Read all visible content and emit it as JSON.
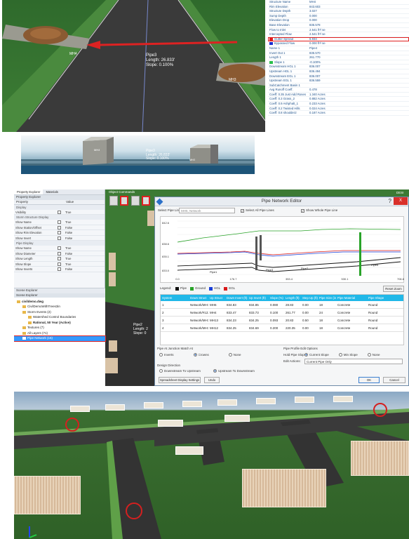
{
  "panel1": {
    "pipe_label": "Pipe3",
    "pipe_length": "Length: 26.833'",
    "pipe_slope": "Slope: 0.100%",
    "mh_left": "MH4",
    "mh_right": "MH3",
    "properties": [
      {
        "k": "Structure Name",
        "v": "MH4",
        "sw": ""
      },
      {
        "k": "Rim Elevation",
        "v": "843.603",
        "sw": ""
      },
      {
        "k": "Structure Depth",
        "v": "3.027",
        "sw": ""
      },
      {
        "k": "Sump Depth",
        "v": "0.000",
        "sw": ""
      },
      {
        "k": "Elevation Drop",
        "v": "0.000",
        "sw": ""
      },
      {
        "k": "Base Elevation",
        "v": "835.578",
        "sw": ""
      },
      {
        "k": "Flow to Inlet",
        "v": "2.541 ft³/ se",
        "sw": ""
      },
      {
        "k": "Intercepted Flow",
        "v": "2.541 ft³/ se",
        "sw": ""
      },
      {
        "k": "Gutter Spread",
        "v": "6.934",
        "sw": "#e02020",
        "highlight": true
      },
      {
        "k": "Bypassed Flow",
        "v": "0.000 ft³/ se",
        "sw": "#1a2bd0"
      },
      {
        "k": "Name 1",
        "v": "Pipe4",
        "sw": ""
      },
      {
        "k": "Invert Out 1",
        "v": "835.570",
        "sw": ""
      },
      {
        "k": "Length 1",
        "v": "261.770",
        "sw": ""
      },
      {
        "k": "Slope 1",
        "v": "-0.100%",
        "sw": "#29c04a"
      },
      {
        "k": "Downstream HGL 1",
        "v": "836.007",
        "sw": ""
      },
      {
        "k": "Upstream HGL 1",
        "v": "836.494",
        "sw": ""
      },
      {
        "k": "Downstream EGL 1",
        "v": "836.007",
        "sw": ""
      },
      {
        "k": "Upstream EGL 1",
        "v": "836.559",
        "sw": ""
      },
      {
        "k": "SubCatchment Basin 1",
        "v": "",
        "sw": ""
      },
      {
        "k": "Avg Runoff Coeff.",
        "v": "0.478",
        "sw": ""
      },
      {
        "k": "Coeff: 0.35 Just Add Roses",
        "v": "1.340 Acres",
        "sw": ""
      },
      {
        "k": "Coeff: 0.3 Grass_2",
        "v": "0.882 Acres",
        "sw": ""
      },
      {
        "k": "Coeff: 0.9 Ashphalt_1",
        "v": "0.233 Acres",
        "sw": ""
      },
      {
        "k": "Coeff: 0.2 Twisted Hills",
        "v": "0.024 Acres",
        "sw": ""
      },
      {
        "k": "Coeff: 0.8 shoulder2",
        "v": "0.187 Acres",
        "sw": ""
      }
    ]
  },
  "panel2": {
    "pipe_label": "Pipe3",
    "pipe_length": "Length: 26.833'",
    "pipe_slope": "Slope: 0.100%",
    "mh_left": "MH4",
    "mh_right": "MH3"
  },
  "panel3": {
    "tabs": [
      "Property Explorer",
      "Materials"
    ],
    "property_explorer_title": "Property Explorer",
    "col_property": "Property",
    "col_value": "Value",
    "properties": [
      {
        "group": "Display"
      },
      {
        "k": "Visibility",
        "v": "True",
        "checked": true
      },
      {
        "group": "Storm Structure Display"
      },
      {
        "k": "Show Name",
        "v": "True",
        "checked": true
      },
      {
        "k": "Show Station/Offset",
        "v": "False",
        "checked": false
      },
      {
        "k": "Show Rim Elevation",
        "v": "False",
        "checked": false
      },
      {
        "k": "Show Invert",
        "v": "False",
        "checked": false
      },
      {
        "group": "Pipe Display"
      },
      {
        "k": "Show Name",
        "v": "True",
        "checked": true
      },
      {
        "k": "Show Diameter",
        "v": "False",
        "checked": false
      },
      {
        "k": "Show Length",
        "v": "True",
        "checked": true
      },
      {
        "k": "Show Slope",
        "v": "True",
        "checked": true
      },
      {
        "k": "Show Inverts",
        "v": "False",
        "checked": false
      }
    ],
    "scene_explorer_tab": "Scene Explorer",
    "scene_explorer_title": "Scene Explorer",
    "tree": [
      {
        "label": "civildemo.dwg",
        "level": 0,
        "bold": true
      },
      {
        "label": "CivilDemoWithTrees3in",
        "level": 1
      },
      {
        "label": "Storm Events (2)",
        "level": 1
      },
      {
        "label": "Watershed Control Boundaries",
        "level": 2
      },
      {
        "label": "Rational, 50 Year (Active)",
        "level": 2,
        "bold": true
      },
      {
        "label": "Textures (7)",
        "level": 1
      },
      {
        "label": "All Layers (71)",
        "level": 1
      },
      {
        "label": "Pipe Network (15)",
        "level": 1,
        "selected": true
      }
    ],
    "object_commands": "Object Commands",
    "bg_pipe_label": "Pipe2",
    "bg_pipe_length": "Length: 2",
    "bg_pipe_slope": "Slope: 0",
    "editor": {
      "title": "Pipe Network Editor",
      "help": "?",
      "close": "X",
      "select_pipe_line_label": "Select Pipe Line:",
      "select_pipe_line_value": "MH5, Network",
      "select_all_label": "Select All Pipe Lines",
      "show_whole_label": "Show Whole Pipe Line",
      "y_ticks": [
        "842.6",
        "838.6",
        "835.1",
        "833.0"
      ],
      "x_ticks": [
        "0.0",
        "176.7",
        "353.4",
        "530.1",
        "706.8"
      ],
      "profile_pipes": [
        "Pipe1",
        "Pipe3",
        "Pipe2",
        "Pipe5"
      ],
      "legend_label": "Legend:",
      "legend": [
        {
          "name": "Pipe",
          "color": "#111111"
        },
        {
          "name": "Ground",
          "color": "#29a329"
        },
        {
          "name": "HGL",
          "color": "#1a3fd8"
        },
        {
          "name": "EGL",
          "color": "#d81a1a"
        }
      ],
      "reset_zoom": "Reset Zoom",
      "columns": [
        "System",
        "Down Struct",
        "Up Struct",
        "Down Invert (ft)",
        "Up Invert (ft)",
        "Slope (%)",
        "Length (ft)",
        "Step Up (ft)",
        "Pipe Size (in)",
        "Pipe Material",
        "Pipe Shape"
      ],
      "rows": [
        [
          "1",
          "Network/MH7",
          "MH6",
          "834.83",
          "834.85",
          "0.080",
          "28.83",
          "0.00",
          "18",
          "Concrete",
          "Round"
        ],
        [
          "2",
          "Network/#1221025.cdx",
          "MH4",
          "833.47",
          "833.73",
          "0.100",
          "261.77",
          "0.00",
          "24",
          "Concrete",
          "Round"
        ],
        [
          "3",
          "Network/MH14",
          "MH13",
          "834.23",
          "834.25",
          "0.093",
          "20.83",
          "0.50",
          "18",
          "Concrete",
          "Round"
        ],
        [
          "4",
          "Network/MH13",
          "MH12",
          "834.25",
          "834.69",
          "0.200",
          "220.35",
          "0.00",
          "18",
          "Concrete",
          "Round"
        ]
      ],
      "junction_title": "Pipe At Junction Match At",
      "junction_options": [
        "Inverts",
        "Crowns",
        "None"
      ],
      "junction_selected": "Crowns",
      "edit_options_title": "Pipe Profile Edit Options",
      "hold_label": "Hold Pipe Slope:",
      "hold_options": [
        "Current Slope",
        "Min Slope",
        "None"
      ],
      "hold_selected": "Current Slope",
      "edit_actions_label": "Edit Actions:",
      "edit_actions_value": "Current Pipe Only",
      "design_direction": "Design Direction",
      "direction_options": [
        "Downstream To Upstream",
        "Upstream To Downstream"
      ],
      "direction_selected": "Upstream To Downstream",
      "spreadsheet_btn": "Spreadsheet Display Settings",
      "undo_btn": "Undo",
      "ok_btn": "OK",
      "cancel_btn": "Cancel"
    },
    "corner_text": "DESI"
  }
}
